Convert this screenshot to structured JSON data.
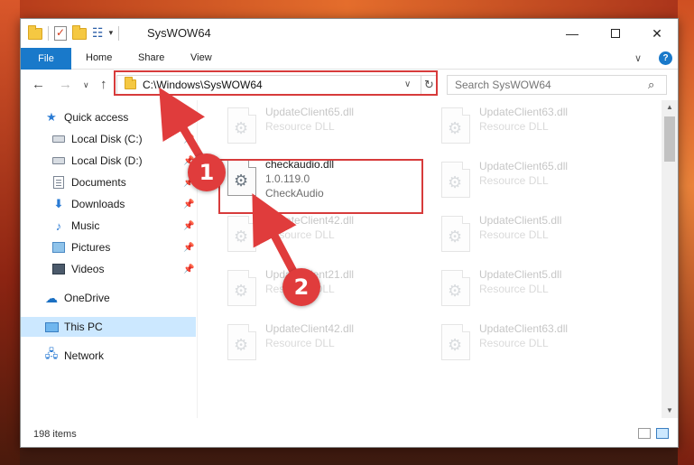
{
  "window": {
    "title": "SysWOW64",
    "minimize_glyph": "—",
    "close_glyph": "✕"
  },
  "ribbon": {
    "file": "File",
    "home": "Home",
    "share": "Share",
    "view": "View",
    "expand_glyph": "∨",
    "help_glyph": "?"
  },
  "nav": {
    "back_glyph": "←",
    "forward_glyph": "→",
    "recent_glyph": "∨",
    "up_glyph": "↑",
    "address": "C:\\Windows\\SysWOW64",
    "address_dropdown_glyph": "∨",
    "refresh_glyph": "↻",
    "search_placeholder": "Search SysWOW64",
    "search_glyph": "⌕"
  },
  "sidebar": {
    "items": [
      {
        "label": "Quick access",
        "icon": "star-icon"
      },
      {
        "label": "Local Disk (C:)",
        "icon": "drive-icon"
      },
      {
        "label": "Local Disk (D:)",
        "icon": "drive-icon"
      },
      {
        "label": "Documents",
        "icon": "documents-icon"
      },
      {
        "label": "Downloads",
        "icon": "download-icon"
      },
      {
        "label": "Music",
        "icon": "music-icon"
      },
      {
        "label": "Pictures",
        "icon": "pictures-icon"
      },
      {
        "label": "Videos",
        "icon": "videos-icon"
      },
      {
        "label": "OneDrive",
        "icon": "cloud-icon"
      },
      {
        "label": "This PC",
        "icon": "computer-icon"
      },
      {
        "label": "Network",
        "icon": "network-icon"
      }
    ],
    "selected": "This PC"
  },
  "files": {
    "active": {
      "name": "checkaudio.dll",
      "version": "1.0.119.0",
      "description": "CheckAudio"
    },
    "faded": [
      {
        "name": "UpdateClient65.dll",
        "type": "Resource DLL"
      },
      {
        "name": "UpdateClient63.dll",
        "type": "Resource DLL"
      },
      {
        "name": "UpdateClient65.dll",
        "type": "Resource DLL"
      },
      {
        "name": "UpdateClient42.dll",
        "type": "Resource DLL"
      },
      {
        "name": "UpdateClient5.dll",
        "type": "Resource DLL"
      },
      {
        "name": "UpdateClient21.dll",
        "type": "Resource DLL"
      },
      {
        "name": "UpdateClient5.dll",
        "type": "Resource DLL"
      },
      {
        "name": "UpdateClient42.dll",
        "type": "Resource DLL"
      },
      {
        "name": "UpdateClient63.dll",
        "type": "Resource DLL"
      }
    ]
  },
  "status": {
    "item_count": "198 items"
  },
  "annotations": {
    "step1": "1",
    "step2": "2",
    "color": "#d73b3b"
  },
  "colors": {
    "accent": "#1979ca",
    "selection": "#cce8ff",
    "annotation_red": "#e03c3c"
  }
}
